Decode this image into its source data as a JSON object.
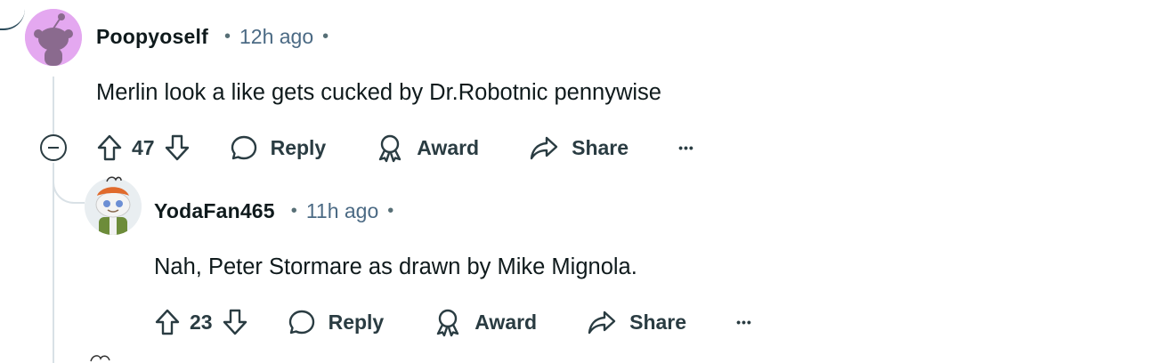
{
  "comments": [
    {
      "username": "Poopyoself",
      "time": "12h ago",
      "body": "Merlin look a like gets cucked by Dr.Robotnic pennywise",
      "votes": "47",
      "reply_label": "Reply",
      "award_label": "Award",
      "share_label": "Share",
      "more_label": "•••"
    },
    {
      "username": "YodaFan465",
      "time": "11h ago",
      "body": "Nah, Peter Stormare as drawn by Mike Mignola.",
      "votes": "23",
      "reply_label": "Reply",
      "award_label": "Award",
      "share_label": "Share",
      "more_label": "•••"
    }
  ],
  "separator": "•",
  "colors": {
    "avatar1_bg": "#e4a8f0",
    "thread_line": "#d9e1e6",
    "timestamp": "#4b6a84"
  },
  "icons": [
    "upvote-icon",
    "downvote-icon",
    "comment-bubble-icon",
    "award-icon",
    "share-icon",
    "collapse-icon"
  ]
}
